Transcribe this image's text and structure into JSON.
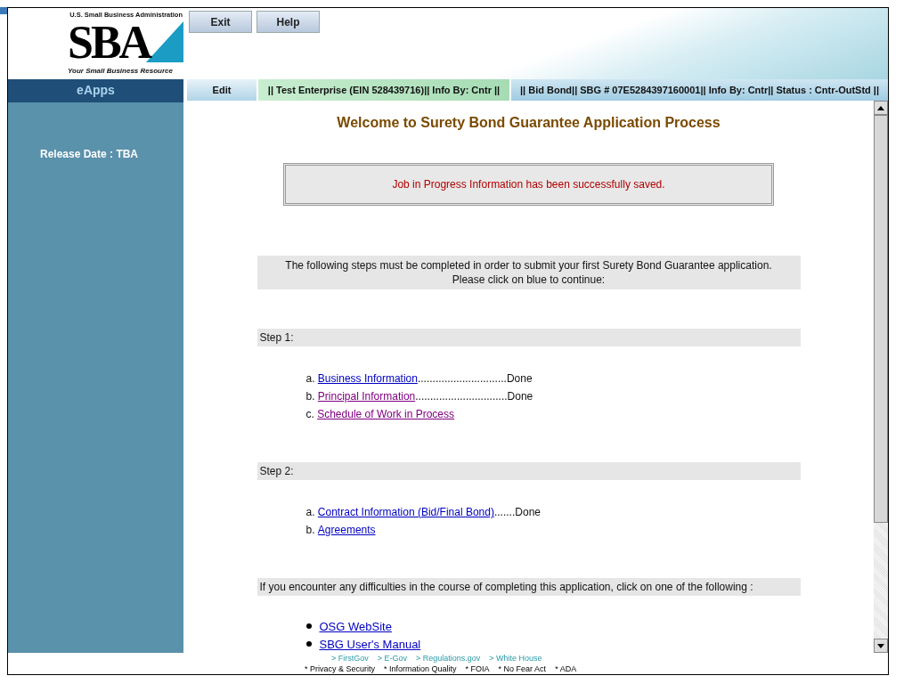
{
  "header": {
    "logo": {
      "agency": "U.S. Small Business Administration",
      "wordmark": "SBA",
      "tagline": "Your Small Business Resource"
    },
    "buttons": [
      "Exit",
      "Help"
    ]
  },
  "nav_bar": {
    "app_title": "eApps",
    "edit": "Edit",
    "enterprise_info": "|| Test Enterprise (EIN 528439716)|| Info By:  Cntr ||",
    "bond_info": "|| Bid Bond|| SBG # 07E5284397160001|| Info By:  Cntr|| Status :  Cntr-OutStd ||"
  },
  "sidebar": {
    "release": "Release Date : TBA"
  },
  "main": {
    "title": "Welcome to Surety Bond Guarantee Application Process",
    "message": "Job in Progress Information has been successfully saved.",
    "instructions": [
      "The following steps must be completed in order to submit your first Surety Bond Guarantee application.",
      "Please click on blue to continue:"
    ],
    "steps": [
      {
        "label": "Step 1:",
        "items": [
          {
            "marker": "a.",
            "link": "Business Information",
            "visited": false,
            "leader": "..............................",
            "status": "Done"
          },
          {
            "marker": "b.",
            "link": "Principal Information",
            "visited": true,
            "leader": "...............................",
            "status": "Done"
          },
          {
            "marker": "c.",
            "link": "Schedule of Work in Process",
            "visited": true
          }
        ]
      },
      {
        "label": "Step 2:",
        "items": [
          {
            "marker": "a.",
            "link": "Contract Information (Bid/Final Bond)",
            "visited": false,
            "leader": ".......",
            "status": "Done"
          },
          {
            "marker": "b.",
            "link": "Agreements",
            "visited": false
          }
        ]
      }
    ],
    "help_text": "If you encounter any difficulties in the course of completing this application, click on one of the following :",
    "help_links": [
      {
        "label": "OSG WebSite",
        "visited": false
      },
      {
        "label": "SBG User's Manual",
        "visited": false
      }
    ]
  },
  "footer": {
    "nav_links": [
      "> FirstGov",
      "> E-Gov",
      "> Regulations.gov",
      "> White House"
    ],
    "policy_links": [
      "* Privacy & Security",
      "* Information Quality",
      "* FOIA",
      "* No Fear Act",
      "* ADA"
    ]
  }
}
